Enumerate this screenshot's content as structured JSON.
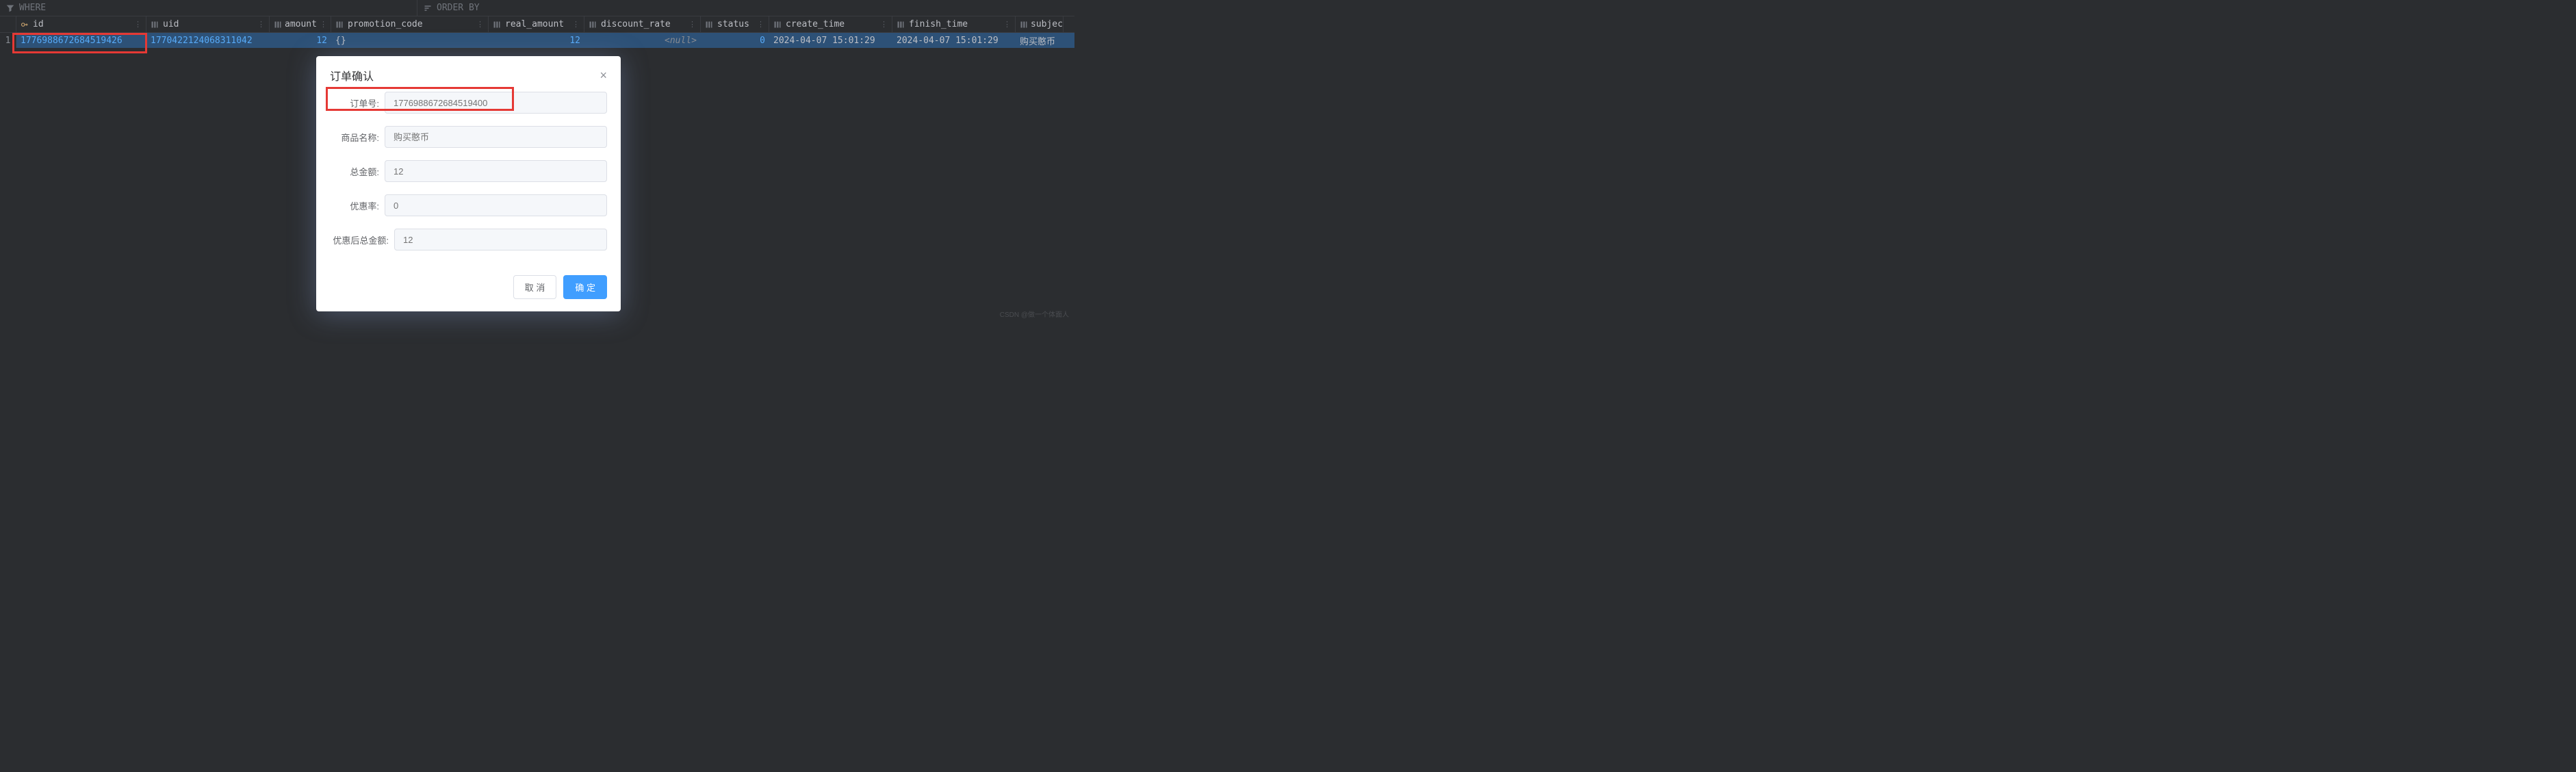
{
  "filters": {
    "where_label": "WHERE",
    "orderby_label": "ORDER BY"
  },
  "columns": [
    {
      "name": "id",
      "icon": "key"
    },
    {
      "name": "uid",
      "icon": "col"
    },
    {
      "name": "amount",
      "icon": "col"
    },
    {
      "name": "promotion_code",
      "icon": "col"
    },
    {
      "name": "real_amount",
      "icon": "col"
    },
    {
      "name": "discount_rate",
      "icon": "col"
    },
    {
      "name": "status",
      "icon": "col"
    },
    {
      "name": "create_time",
      "icon": "col"
    },
    {
      "name": "finish_time",
      "icon": "col"
    },
    {
      "name": "subject",
      "icon": "col"
    }
  ],
  "rows": [
    {
      "num": "1",
      "id": "1776988672684519426",
      "uid": "1770422124068311042",
      "amount": "12",
      "promotion_code": "{}",
      "real_amount": "12",
      "discount_rate": "<null>",
      "status": "0",
      "create_time": "2024-04-07 15:01:29",
      "finish_time": "2024-04-07 15:01:29",
      "subject": "购买憨币"
    }
  ],
  "modal": {
    "title": "订单确认",
    "fields": {
      "order_no_label": "订单号:",
      "order_no_value": "1776988672684519400",
      "product_label": "商品名称:",
      "product_value": "购买憨币",
      "total_label": "总金额:",
      "total_value": "12",
      "discount_label": "优惠率:",
      "discount_value": "0",
      "final_label": "优惠后总金额:",
      "final_value": "12"
    },
    "cancel_label": "取 消",
    "confirm_label": "确 定"
  },
  "watermark": "CSDN @做一个体面人"
}
